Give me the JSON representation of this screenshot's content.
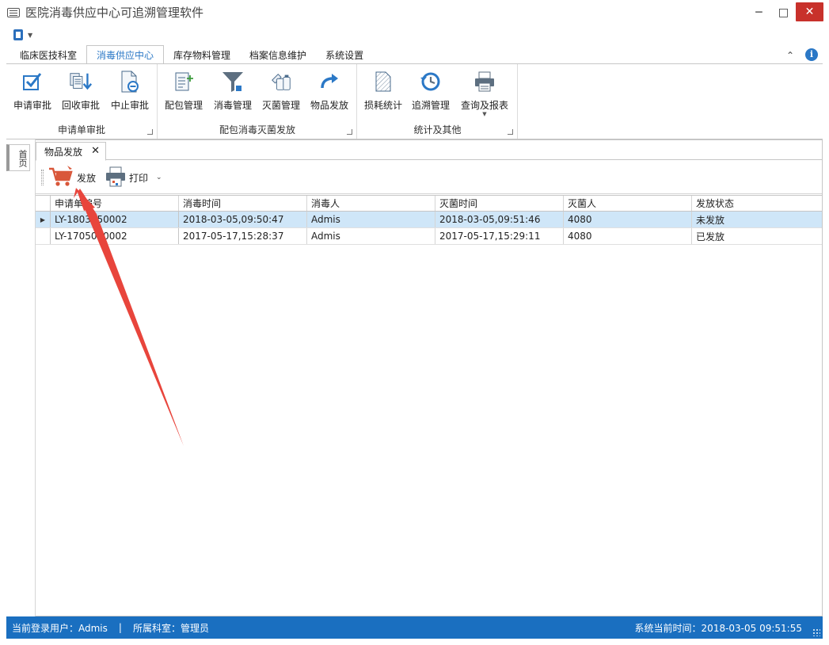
{
  "window": {
    "title": "医院消毒供应中心可追溯管理软件"
  },
  "ribbon_tabs": [
    {
      "label": "临床医技科室"
    },
    {
      "label": "消毒供应中心"
    },
    {
      "label": "库存物料管理"
    },
    {
      "label": "档案信息维护"
    },
    {
      "label": "系统设置"
    }
  ],
  "ribbon_groups": [
    {
      "label": "申请单审批",
      "buttons": [
        {
          "label": "申请审批"
        },
        {
          "label": "回收审批"
        },
        {
          "label": "中止审批"
        }
      ]
    },
    {
      "label": "配包消毒灭菌发放",
      "buttons": [
        {
          "label": "配包管理"
        },
        {
          "label": "消毒管理"
        },
        {
          "label": "灭菌管理"
        },
        {
          "label": "物品发放"
        }
      ]
    },
    {
      "label": "统计及其他",
      "buttons": [
        {
          "label": "损耗统计"
        },
        {
          "label": "追溯管理"
        },
        {
          "label": "查询及报表"
        }
      ]
    }
  ],
  "left_panel": {
    "tab_label": "首页"
  },
  "document_tab": {
    "label": "物品发放"
  },
  "toolbar": {
    "issue_label": "发放",
    "print_label": "打印"
  },
  "grid": {
    "columns": [
      "申请单编号",
      "消毒时间",
      "消毒人",
      "灭菌时间",
      "灭菌人",
      "发放状态"
    ],
    "rows": [
      [
        "LY-1803050002",
        "2018-03-05,09:50:47",
        "Admis",
        "2018-03-05,09:51:46",
        "4080",
        "未发放"
      ],
      [
        "LY-1705050002",
        "2017-05-17,15:28:37",
        "Admis",
        "2017-05-17,15:29:11",
        "4080",
        "已发放"
      ]
    ]
  },
  "statusbar": {
    "user_text": "当前登录用户：Admis",
    "separator": "|",
    "dept_text": "所属科室：管理员",
    "time_text": "系统当前时间：2018-03-05 09:51:55"
  },
  "colors": {
    "accent": "#2b78c6",
    "status_bar": "#1a6fc0",
    "close_button": "#c8312b",
    "selected_row": "#cfe6f8",
    "annotation_arrow": "#e8453c"
  }
}
